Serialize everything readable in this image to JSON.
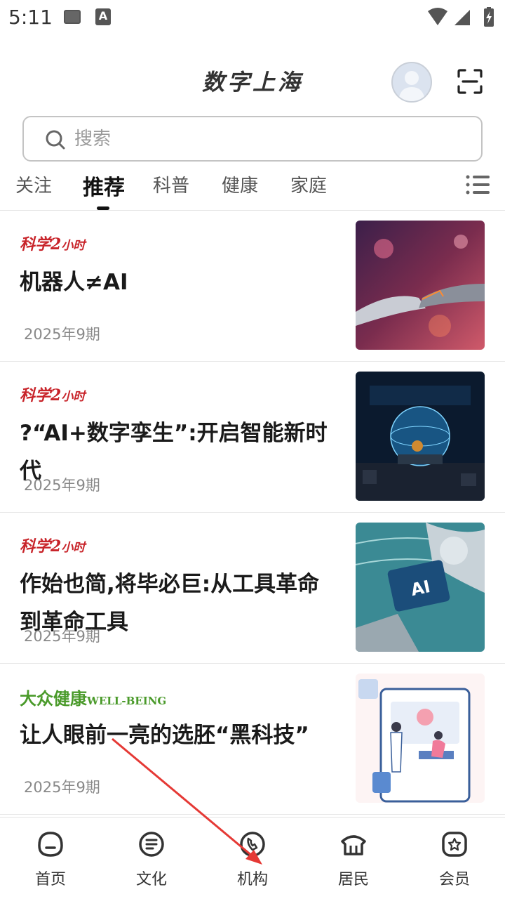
{
  "status_bar": {
    "time": "5:11"
  },
  "header": {
    "title": "数字上海"
  },
  "search": {
    "placeholder": "搜索"
  },
  "tabs": [
    {
      "label": "关注",
      "active": false
    },
    {
      "label": "推荐",
      "active": true
    },
    {
      "label": "科普",
      "active": false
    },
    {
      "label": "健康",
      "active": false
    },
    {
      "label": "家庭",
      "active": false
    }
  ],
  "articles": [
    {
      "source_logo_main": "科学2",
      "source_logo_small": "小时",
      "title": "机器人≠AI",
      "date": "2025年9期",
      "thumb_icon": "robot-handshake-image"
    },
    {
      "source_logo_main": "科学2",
      "source_logo_small": "小时",
      "title": "?“AI+数字孪生”:开启智能新时代",
      "date": "2025年9期",
      "thumb_icon": "digital-twin-globe-image"
    },
    {
      "source_logo_main": "科学2",
      "source_logo_small": "小时",
      "title": "作始也简,将毕必巨:从工具革命到革命工具",
      "date": "2025年9期",
      "thumb_icon": "robot-ai-chip-image"
    },
    {
      "source_logo_main": "大众健康",
      "source_logo_small": "WELL-BEING",
      "title": "让人眼前一亮的选胚“黑科技”",
      "date": "2025年9期",
      "thumb_icon": "doctor-patient-illustration"
    }
  ],
  "bottom_nav": [
    {
      "label": "首页",
      "icon": "home-icon"
    },
    {
      "label": "文化",
      "icon": "culture-icon"
    },
    {
      "label": "机构",
      "icon": "institution-icon"
    },
    {
      "label": "居民",
      "icon": "resident-icon"
    },
    {
      "label": "会员",
      "icon": "member-icon"
    }
  ],
  "colors": {
    "accent_red": "#c8242a",
    "accent_green": "#4a9a2a",
    "annotation_arrow": "#e53935"
  }
}
